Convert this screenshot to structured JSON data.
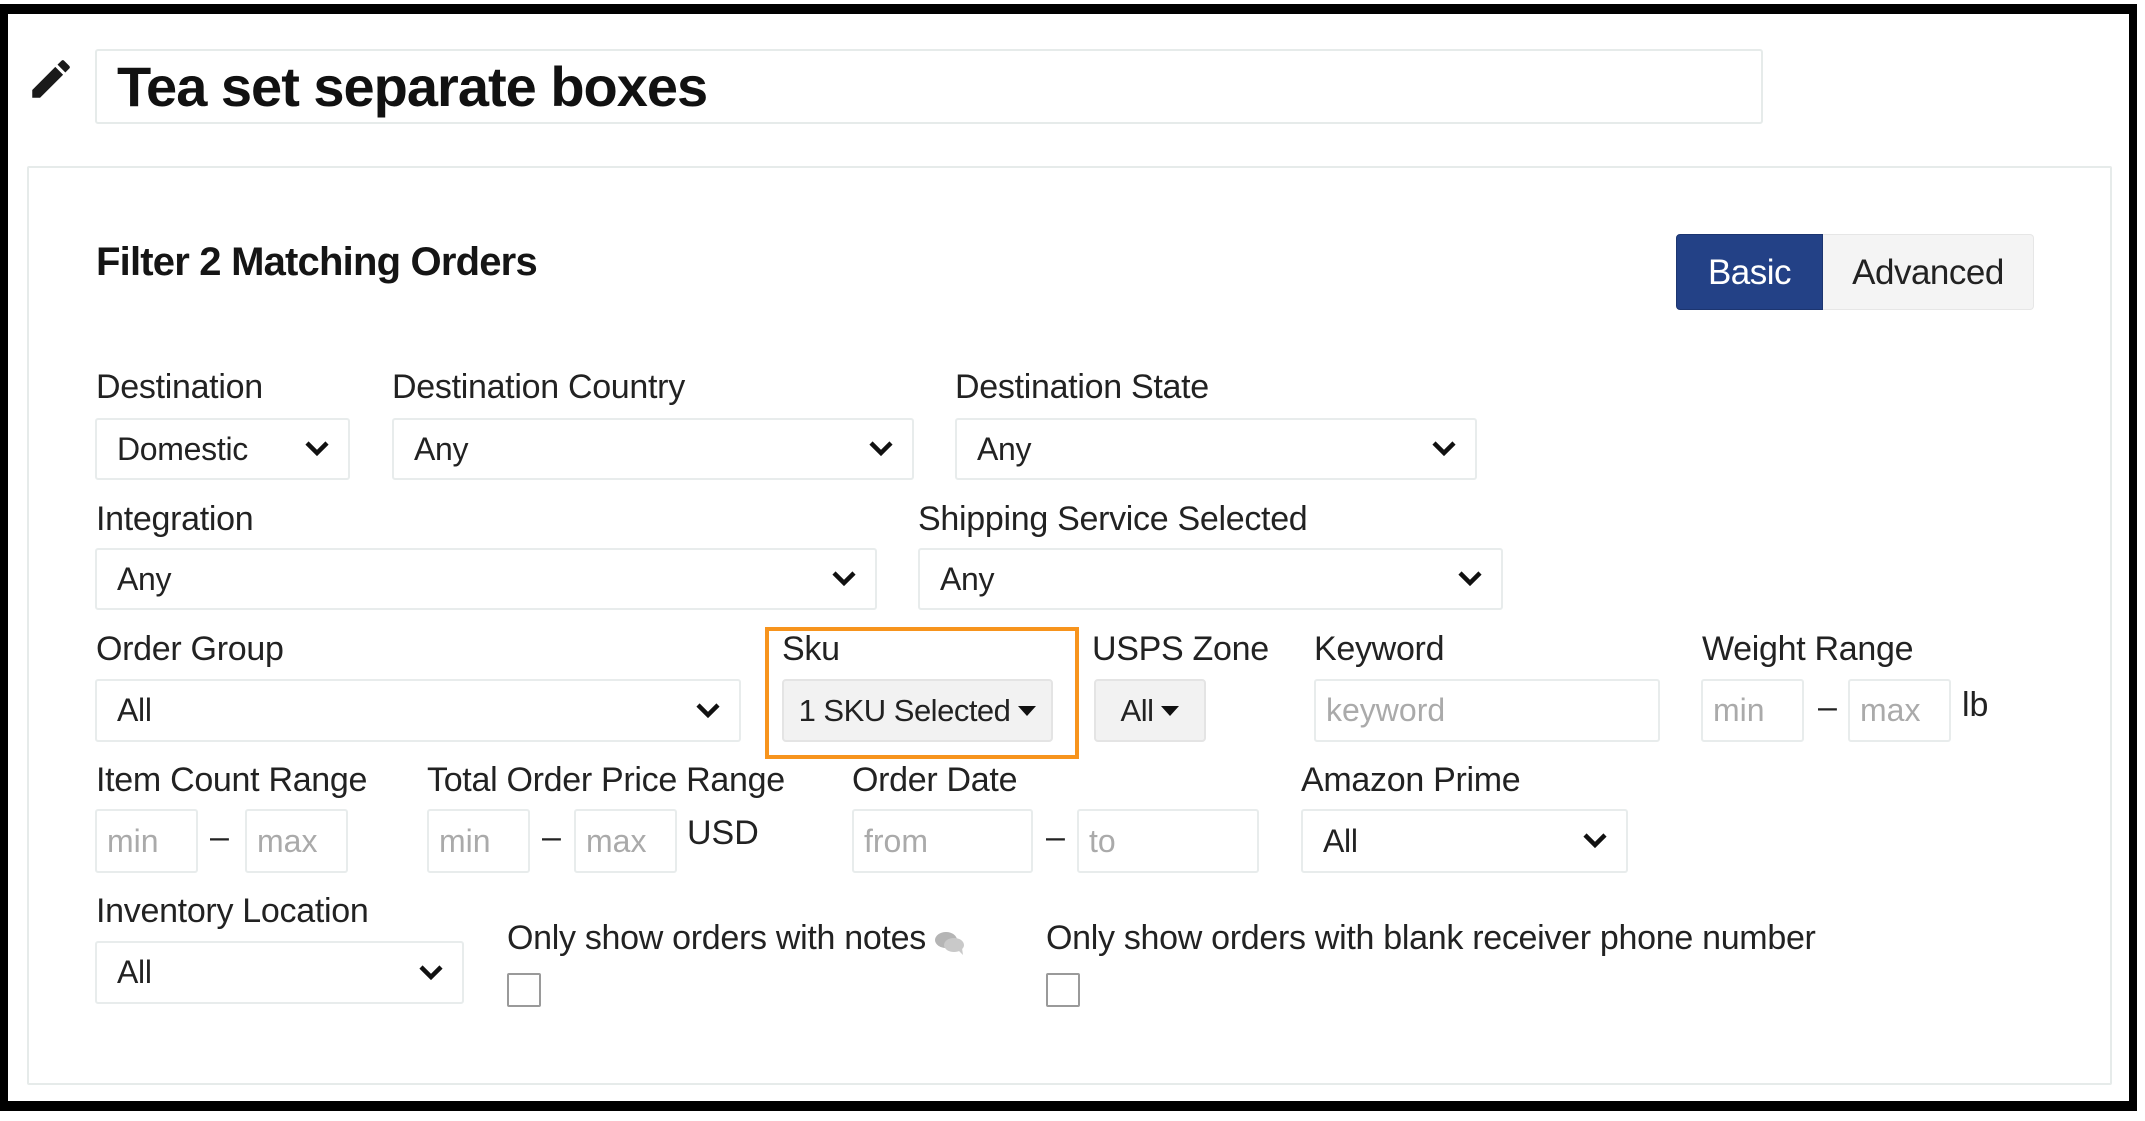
{
  "title": {
    "value": "Tea set separate boxes",
    "edit_icon": "pencil-icon"
  },
  "filter": {
    "heading": "Filter 2 Matching Orders",
    "mode_toggle": {
      "basic_label": "Basic",
      "advanced_label": "Advanced",
      "selected": "Basic",
      "active_color": "#234186"
    },
    "destination": {
      "label": "Destination",
      "value": "Domestic"
    },
    "destination_country": {
      "label": "Destination Country",
      "value": "Any"
    },
    "destination_state": {
      "label": "Destination State",
      "value": "Any"
    },
    "integration": {
      "label": "Integration",
      "value": "Any"
    },
    "shipping_service": {
      "label": "Shipping Service Selected",
      "value": "Any"
    },
    "order_group": {
      "label": "Order Group",
      "value": "All"
    },
    "sku": {
      "label": "Sku",
      "value": "1 SKU Selected",
      "highlight_color": "#f7941d"
    },
    "usps_zone": {
      "label": "USPS Zone",
      "value": "All"
    },
    "keyword": {
      "label": "Keyword",
      "placeholder": "keyword",
      "value": ""
    },
    "weight_range": {
      "label": "Weight Range",
      "min_placeholder": "min",
      "max_placeholder": "max",
      "separator": "–",
      "unit": "lb"
    },
    "item_count_range": {
      "label": "Item Count Range",
      "min_placeholder": "min",
      "max_placeholder": "max",
      "separator": "–"
    },
    "total_order_price_range": {
      "label": "Total Order Price Range",
      "min_placeholder": "min",
      "max_placeholder": "max",
      "separator": "–",
      "unit": "USD"
    },
    "order_date": {
      "label": "Order Date",
      "from_placeholder": "from",
      "to_placeholder": "to",
      "separator": "–"
    },
    "amazon_prime": {
      "label": "Amazon Prime",
      "value": "All"
    },
    "inventory_location": {
      "label": "Inventory Location",
      "value": "All"
    },
    "notes_only": {
      "label": "Only show orders with notes",
      "icon": "comments-icon",
      "checked": false
    },
    "blank_phone_only": {
      "label": "Only show orders with blank receiver phone number",
      "checked": false
    }
  }
}
